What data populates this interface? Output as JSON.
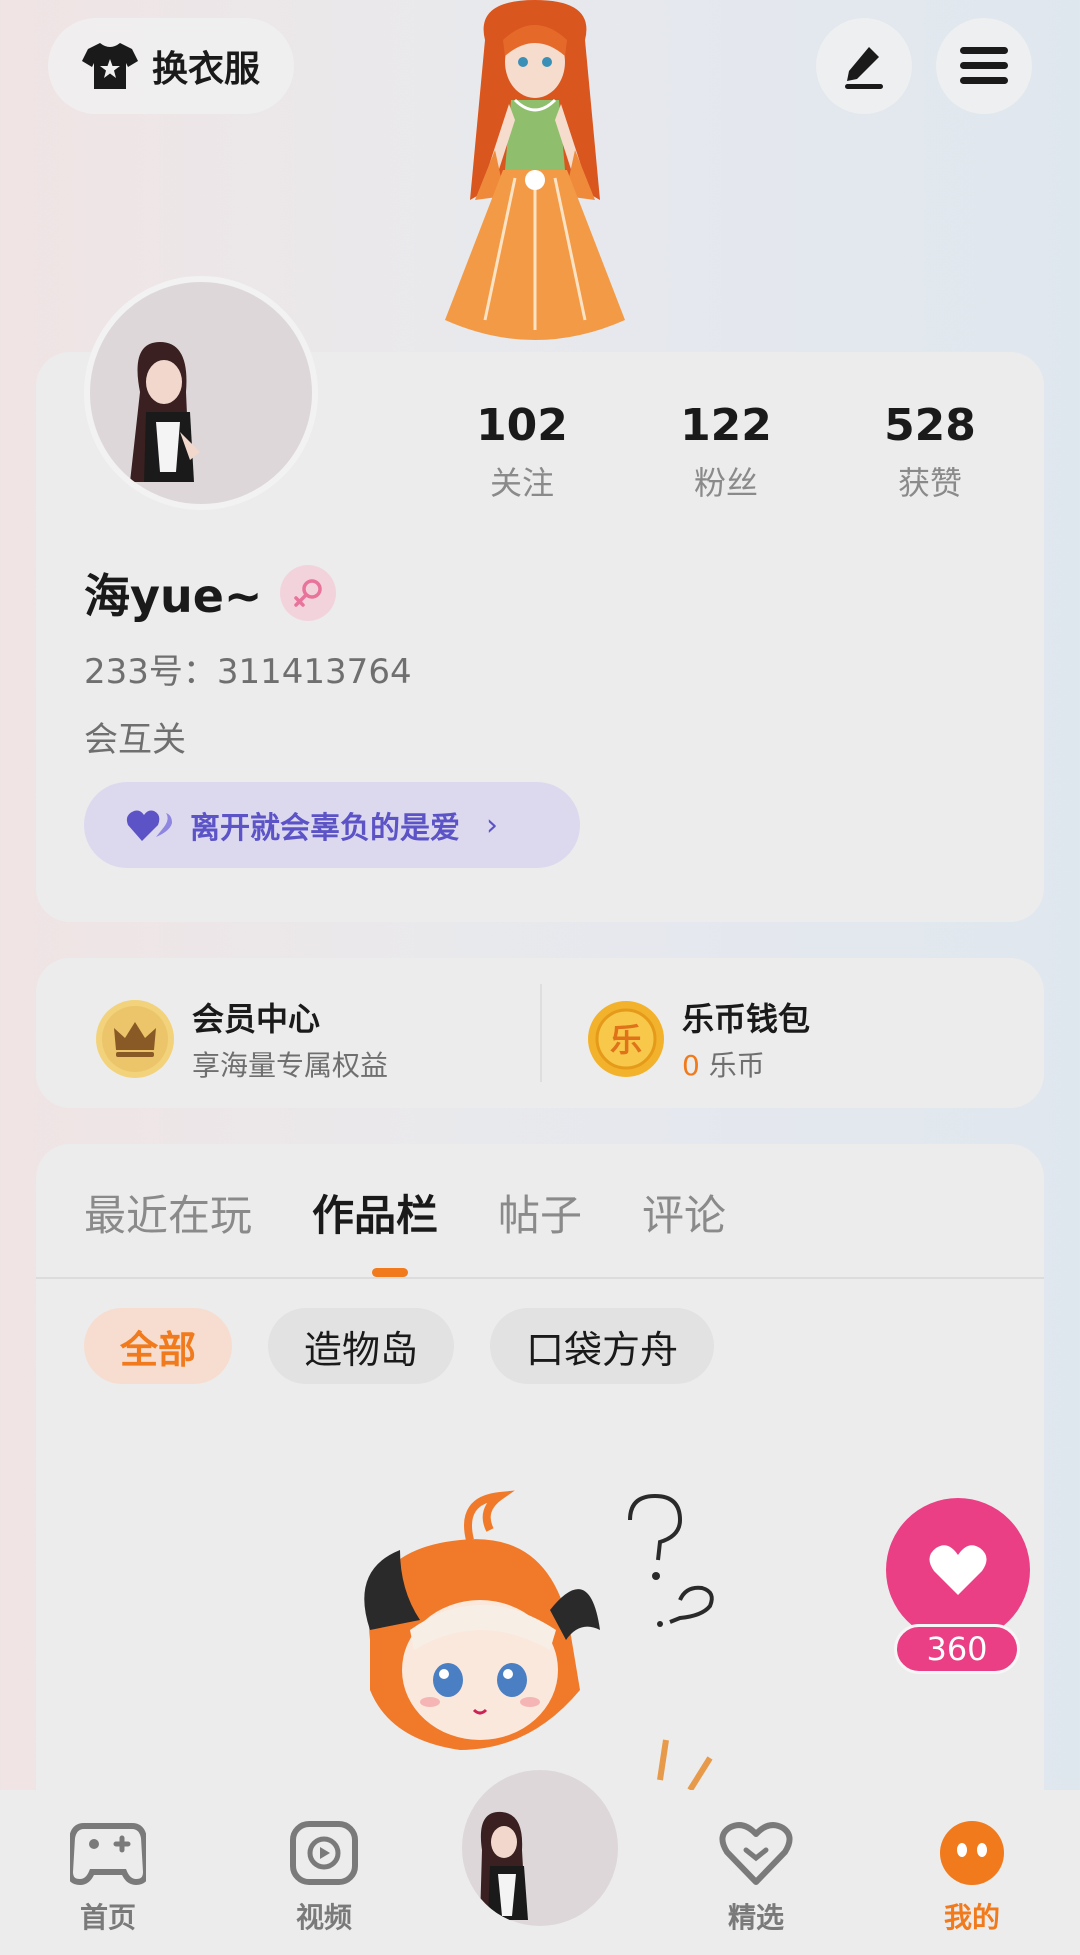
{
  "header": {
    "outfit_label": "换衣服",
    "outfit_icon": "shirt-icon",
    "edit_icon": "pen-icon",
    "menu_icon": "hamburger-menu-icon"
  },
  "profile": {
    "stats": [
      {
        "value": "102",
        "label": "关注"
      },
      {
        "value": "122",
        "label": "粉丝"
      },
      {
        "value": "528",
        "label": "获赞"
      }
    ],
    "username": "海yue~",
    "gender_icon": "female-icon",
    "uid": "233号：311413764",
    "bio": "会互关",
    "signature": "离开就会辜负的是爱"
  },
  "member": {
    "title": "会员中心",
    "subtitle": "享海量专属权益",
    "icon": "crown-icon"
  },
  "wallet": {
    "title": "乐币钱包",
    "amount": "0",
    "unit": "乐币",
    "icon_text": "乐"
  },
  "works": {
    "tabs": [
      "最近在玩",
      "作品栏",
      "帖子",
      "评论"
    ],
    "active_tab": "作品栏",
    "filters": [
      "全部",
      "造物岛",
      "口袋方舟"
    ],
    "active_filter": "全部"
  },
  "like": {
    "count": "360"
  },
  "bottom_nav": {
    "items": [
      {
        "label": "首页",
        "icon": "gamepad-icon"
      },
      {
        "label": "视频",
        "icon": "play-icon"
      },
      {
        "label": "精选",
        "icon": "heart-badge-icon"
      },
      {
        "label": "我的",
        "icon": "face-icon"
      }
    ],
    "active": "我的"
  },
  "colors": {
    "accent": "#f07a1c",
    "like": "#ea3f84",
    "signature": "#5b53c6"
  }
}
